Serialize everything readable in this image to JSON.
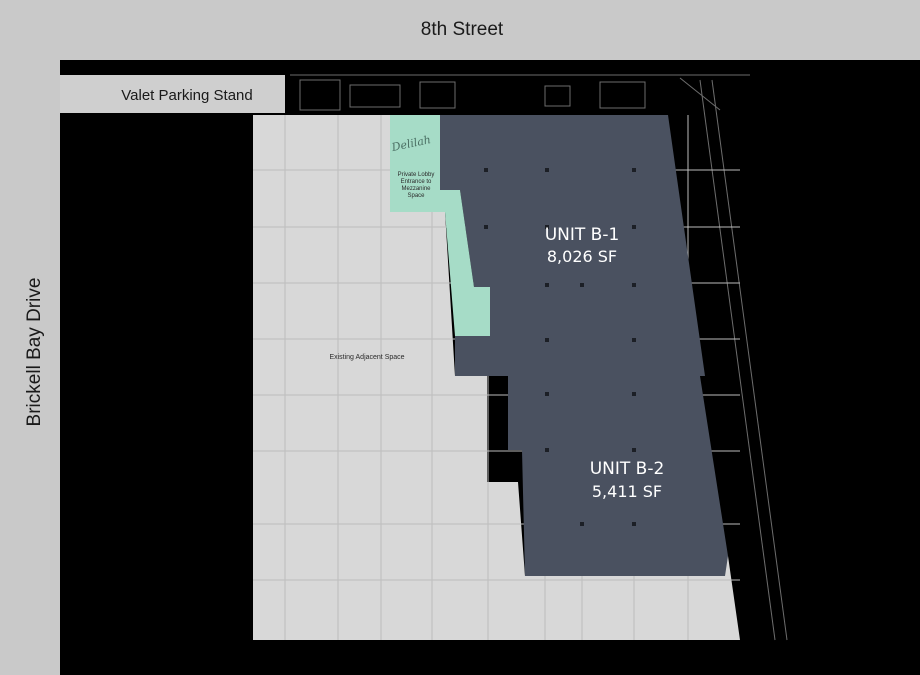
{
  "streets": {
    "top": "8th Street",
    "left": "Brickell Bay Drive"
  },
  "valet": "Valet Parking Stand",
  "adjacent": "Existing Adjacent Space",
  "lobby": {
    "logo": "Delilah",
    "lines": [
      "Private Lobby",
      "Entrance to",
      "Mezzanine",
      "Space"
    ]
  },
  "units": [
    {
      "name": "UNIT B-1",
      "area": "8,026 SF"
    },
    {
      "name": "UNIT B-2",
      "area": "5,411 SF"
    }
  ],
  "colors": {
    "background": "#c9c9c9",
    "building": "#000000",
    "adjacent_space": "#d8d8d8",
    "unit": "#4a5160",
    "lobby": "#a6dcc7",
    "grid": "#bdbdbd"
  }
}
